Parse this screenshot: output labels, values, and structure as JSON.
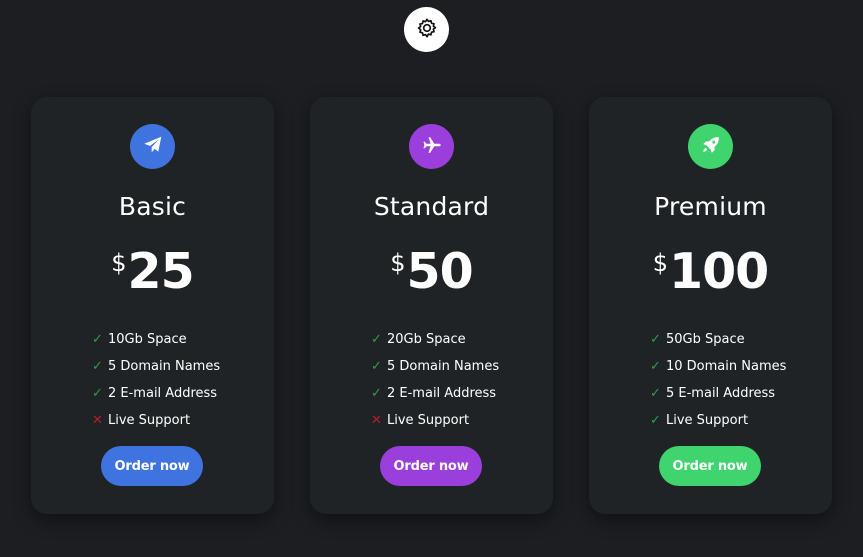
{
  "settings": {
    "icon": "gear-icon"
  },
  "plans": [
    {
      "name": "Basic",
      "currency": "$",
      "price": "25",
      "icon": "paper-plane-icon",
      "color": "#3f74e0",
      "features": [
        {
          "text": "10Gb Space",
          "included": true
        },
        {
          "text": "5 Domain Names",
          "included": true
        },
        {
          "text": "2 E-mail Address",
          "included": true
        },
        {
          "text": "Live Support",
          "included": false
        }
      ],
      "button": "Order now"
    },
    {
      "name": "Standard",
      "currency": "$",
      "price": "50",
      "icon": "airplane-icon",
      "color": "#9a3fdc",
      "features": [
        {
          "text": "20Gb Space",
          "included": true
        },
        {
          "text": "5 Domain Names",
          "included": true
        },
        {
          "text": "2 E-mail Address",
          "included": true
        },
        {
          "text": "Live Support",
          "included": false
        }
      ],
      "button": "Order now"
    },
    {
      "name": "Premium",
      "currency": "$",
      "price": "100",
      "icon": "rocket-icon",
      "color": "#3fd46e",
      "features": [
        {
          "text": "50Gb Space",
          "included": true
        },
        {
          "text": "10 Domain Names",
          "included": true
        },
        {
          "text": "5 E-mail Address",
          "included": true
        },
        {
          "text": "Live Support",
          "included": true
        }
      ],
      "button": "Order now"
    }
  ],
  "marks": {
    "included": "✓",
    "excluded": "✕"
  }
}
